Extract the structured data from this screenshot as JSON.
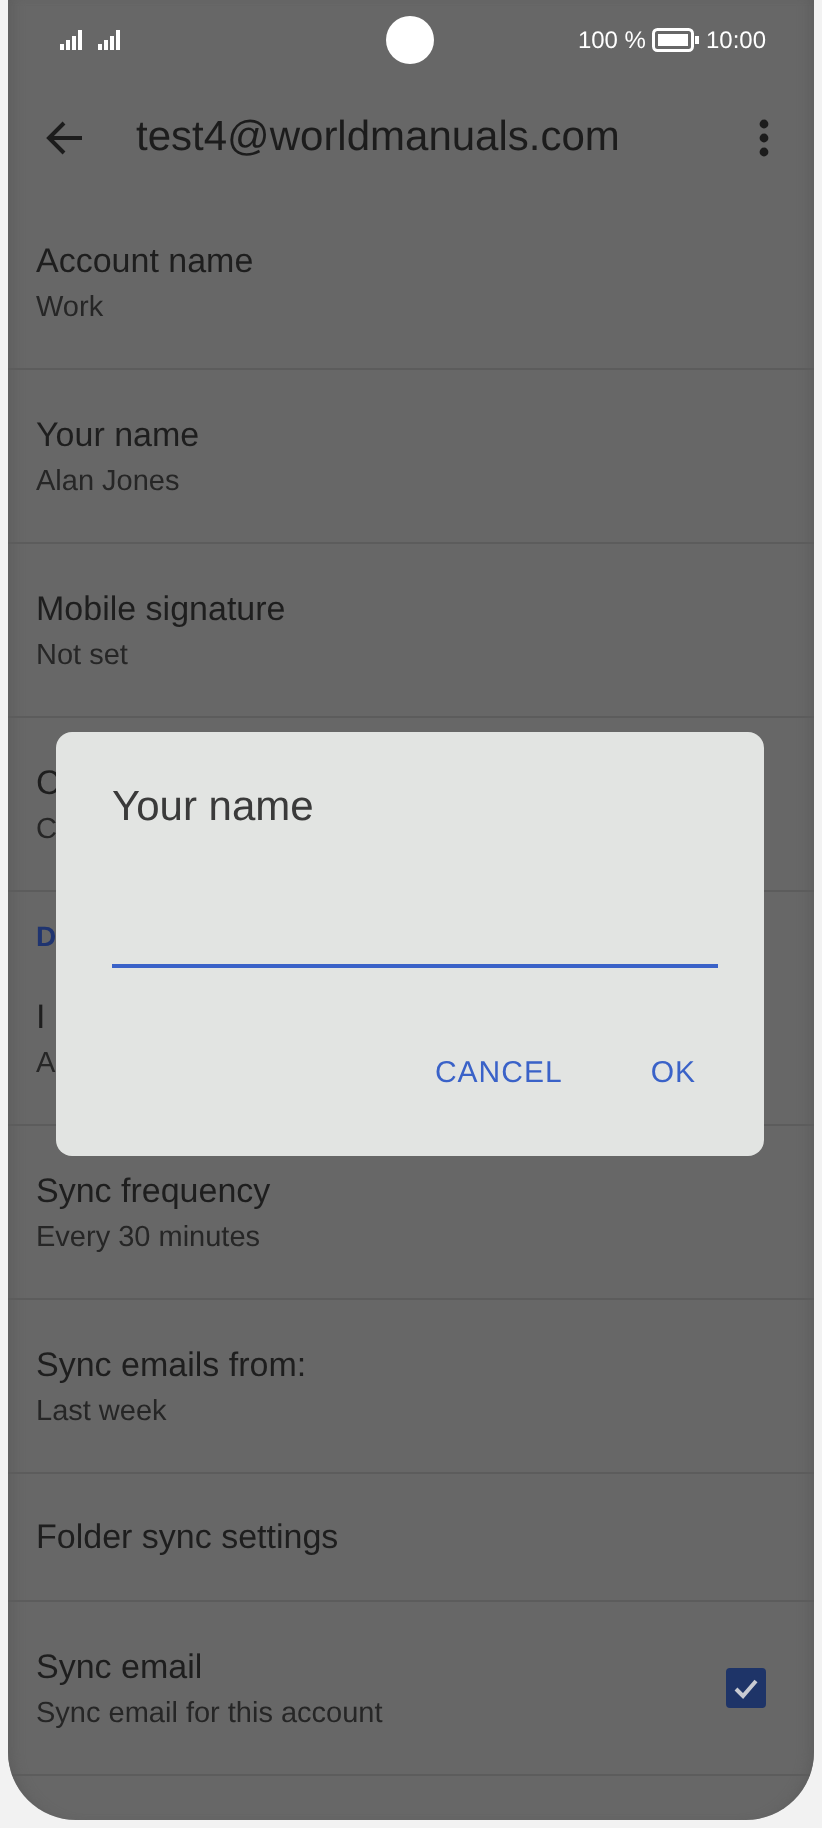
{
  "status_bar": {
    "battery": "100 %",
    "time": "10:00"
  },
  "toolbar": {
    "title": "test4@worldmanuals.com"
  },
  "settings": [
    {
      "kind": "item",
      "title": "Account name",
      "subtitle": "Work"
    },
    {
      "kind": "item",
      "title": "Your name",
      "subtitle": "Alan Jones"
    },
    {
      "kind": "item",
      "title": "Mobile signature",
      "subtitle": "Not set"
    },
    {
      "kind": "item",
      "title": "C",
      "subtitle": "C"
    },
    {
      "kind": "header",
      "title": "D"
    },
    {
      "kind": "item",
      "title": "I",
      "subtitle": "A"
    },
    {
      "kind": "item",
      "title": "Sync frequency",
      "subtitle": "Every 30 minutes"
    },
    {
      "kind": "item",
      "title": "Sync emails from:",
      "subtitle": "Last week"
    },
    {
      "kind": "item",
      "title": "Folder sync settings"
    },
    {
      "kind": "checkbox",
      "title": "Sync email",
      "subtitle": "Sync email for this account",
      "checked": true
    }
  ],
  "dialog": {
    "title": "Your name",
    "buttons": [
      "CANCEL",
      "OK"
    ]
  }
}
